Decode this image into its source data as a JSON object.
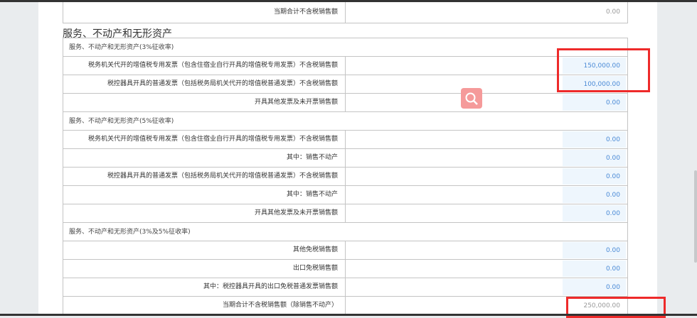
{
  "top_row": {
    "label": "当期合计不含税销售额",
    "value": "0.00"
  },
  "section_title": "服务、不动产和无形资产",
  "groups": [
    {
      "header": "服务、不动产和无形资产(3%征收率)",
      "rows": [
        {
          "label": "税务机关代开的增值税专用发票（包含住宿业自行开具的增值税专用发票）不含税销售额",
          "value": "150,000.00"
        },
        {
          "label": "税控器具开具的普通发票（包括税务局机关代开的增值税普通发票）不含税销售额",
          "value": "100,000.00"
        },
        {
          "label": "开具其他发票及未开票销售额",
          "value": "0.00"
        }
      ]
    },
    {
      "header": "服务、不动产和无形资产(5%征收率)",
      "rows": [
        {
          "label": "税务机关代开的增值税专用发票（包含住宿业自行开具的增值税专用发票）不含税销售额",
          "value": "0.00"
        },
        {
          "label": "其中：销售不动产",
          "value": "0.00"
        },
        {
          "label": "税控器具开具的普通发票（包括税务局机关代开的增值税普通发票）不含税销售额",
          "value": "0.00"
        },
        {
          "label": "其中：销售不动产",
          "value": "0.00"
        },
        {
          "label": "开具其他发票及未开票销售额",
          "value": "0.00"
        }
      ]
    },
    {
      "header": "服务、不动产和无形资产(3%及5%征收率)",
      "rows": [
        {
          "label": "其他免税销售额",
          "value": "0.00"
        },
        {
          "label": "出口免税销售额",
          "value": "0.00"
        },
        {
          "label": "其中：税控器具开具的出口免税普通发票销售额",
          "value": "0.00"
        },
        {
          "label": "当期合计不含税销售额（除销售不动产）",
          "value": "250,000.00"
        }
      ]
    }
  ],
  "colors": {
    "highlight": "#ee2a2a",
    "value_text": "#4a8ad6",
    "value_bg": "#eef6fd"
  }
}
